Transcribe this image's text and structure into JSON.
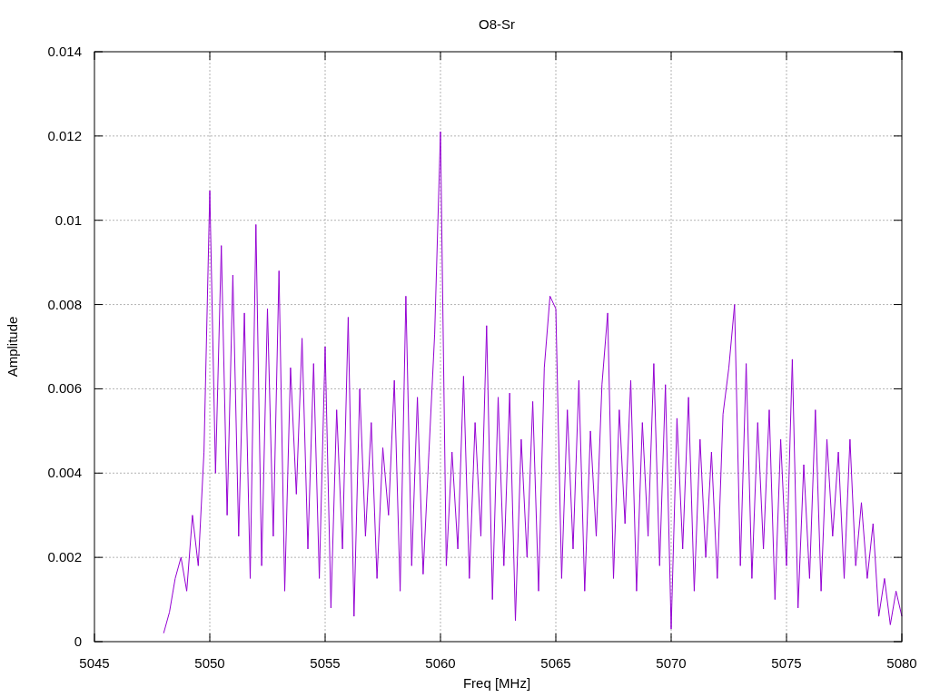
{
  "chart_data": {
    "type": "line",
    "grid": true,
    "title": "O8-Sr",
    "xlabel": "Freq [MHz]",
    "ylabel": "Amplitude",
    "xlim": [
      5045,
      5080
    ],
    "ylim": [
      0,
      0.014
    ],
    "xticks": [
      5045,
      5050,
      5055,
      5060,
      5065,
      5070,
      5075,
      5080
    ],
    "yticks": [
      {
        "value": 0,
        "label": "0"
      },
      {
        "value": 0.002,
        "label": "0.002"
      },
      {
        "value": 0.004,
        "label": "0.004"
      },
      {
        "value": 0.006,
        "label": "0.006"
      },
      {
        "value": 0.008,
        "label": "0.008"
      },
      {
        "value": 0.01,
        "label": "0.01"
      },
      {
        "value": 0.012,
        "label": "0.012"
      },
      {
        "value": 0.014,
        "label": "0.014"
      }
    ],
    "x": [
      5048,
      5048.25,
      5048.5,
      5048.75,
      5049,
      5049.25,
      5049.5,
      5049.75,
      5050,
      5050.25,
      5050.5,
      5050.75,
      5051,
      5051.25,
      5051.5,
      5051.75,
      5052,
      5052.25,
      5052.5,
      5052.75,
      5053,
      5053.25,
      5053.5,
      5053.75,
      5054,
      5054.25,
      5054.5,
      5054.75,
      5055,
      5055.25,
      5055.5,
      5055.75,
      5056,
      5056.25,
      5056.5,
      5056.75,
      5057,
      5057.25,
      5057.5,
      5057.75,
      5058,
      5058.25,
      5058.5,
      5058.75,
      5059,
      5059.25,
      5059.5,
      5059.75,
      5060,
      5060.25,
      5060.5,
      5060.75,
      5061,
      5061.25,
      5061.5,
      5061.75,
      5062,
      5062.25,
      5062.5,
      5062.75,
      5063,
      5063.25,
      5063.5,
      5063.75,
      5064,
      5064.25,
      5064.5,
      5064.75,
      5065,
      5065.25,
      5065.5,
      5065.75,
      5066,
      5066.25,
      5066.5,
      5066.75,
      5067,
      5067.25,
      5067.5,
      5067.75,
      5068,
      5068.25,
      5068.5,
      5068.75,
      5069,
      5069.25,
      5069.5,
      5069.75,
      5070,
      5070.25,
      5070.5,
      5070.75,
      5071,
      5071.25,
      5071.5,
      5071.75,
      5072,
      5072.25,
      5072.5,
      5072.75,
      5073,
      5073.25,
      5073.5,
      5073.75,
      5074,
      5074.25,
      5074.5,
      5074.75,
      5075,
      5075.25,
      5075.5,
      5075.75,
      5076,
      5076.25,
      5076.5,
      5076.75,
      5077,
      5077.25,
      5077.5,
      5077.75,
      5078,
      5078.25,
      5078.5,
      5078.75,
      5079,
      5079.25,
      5079.5,
      5079.75,
      5080
    ],
    "series": [
      {
        "color": "#9400d3",
        "values": [
          0.0002,
          0.0007,
          0.0015,
          0.002,
          0.0012,
          0.003,
          0.0018,
          0.0045,
          0.0107,
          0.004,
          0.0094,
          0.003,
          0.0087,
          0.0025,
          0.0078,
          0.0015,
          0.0099,
          0.0018,
          0.0079,
          0.0025,
          0.0088,
          0.0012,
          0.0065,
          0.0035,
          0.0072,
          0.0022,
          0.0066,
          0.0015,
          0.007,
          0.0008,
          0.0055,
          0.0022,
          0.0077,
          0.0006,
          0.006,
          0.0025,
          0.0052,
          0.0015,
          0.0046,
          0.003,
          0.0062,
          0.0012,
          0.0082,
          0.0018,
          0.0058,
          0.0016,
          0.0045,
          0.0073,
          0.0121,
          0.0018,
          0.0045,
          0.0022,
          0.0063,
          0.0015,
          0.0052,
          0.0025,
          0.0075,
          0.001,
          0.0058,
          0.0018,
          0.0059,
          0.0005,
          0.0048,
          0.002,
          0.0057,
          0.0012,
          0.0065,
          0.0082,
          0.0079,
          0.0015,
          0.0055,
          0.0022,
          0.0062,
          0.0012,
          0.005,
          0.0025,
          0.0061,
          0.0078,
          0.0015,
          0.0055,
          0.0028,
          0.0062,
          0.0012,
          0.0052,
          0.0025,
          0.0066,
          0.0018,
          0.0061,
          0.0003,
          0.0053,
          0.0022,
          0.0058,
          0.0012,
          0.0048,
          0.002,
          0.0045,
          0.0015,
          0.0054,
          0.0065,
          0.008,
          0.0018,
          0.0066,
          0.0015,
          0.0052,
          0.0022,
          0.0055,
          0.001,
          0.0048,
          0.0018,
          0.0067,
          0.0008,
          0.0042,
          0.0015,
          0.0055,
          0.0012,
          0.0048,
          0.0025,
          0.0045,
          0.0015,
          0.0048,
          0.0018,
          0.0033,
          0.0015,
          0.0028,
          0.0006,
          0.0015,
          0.0004,
          0.0012,
          0.0006
        ]
      }
    ]
  }
}
